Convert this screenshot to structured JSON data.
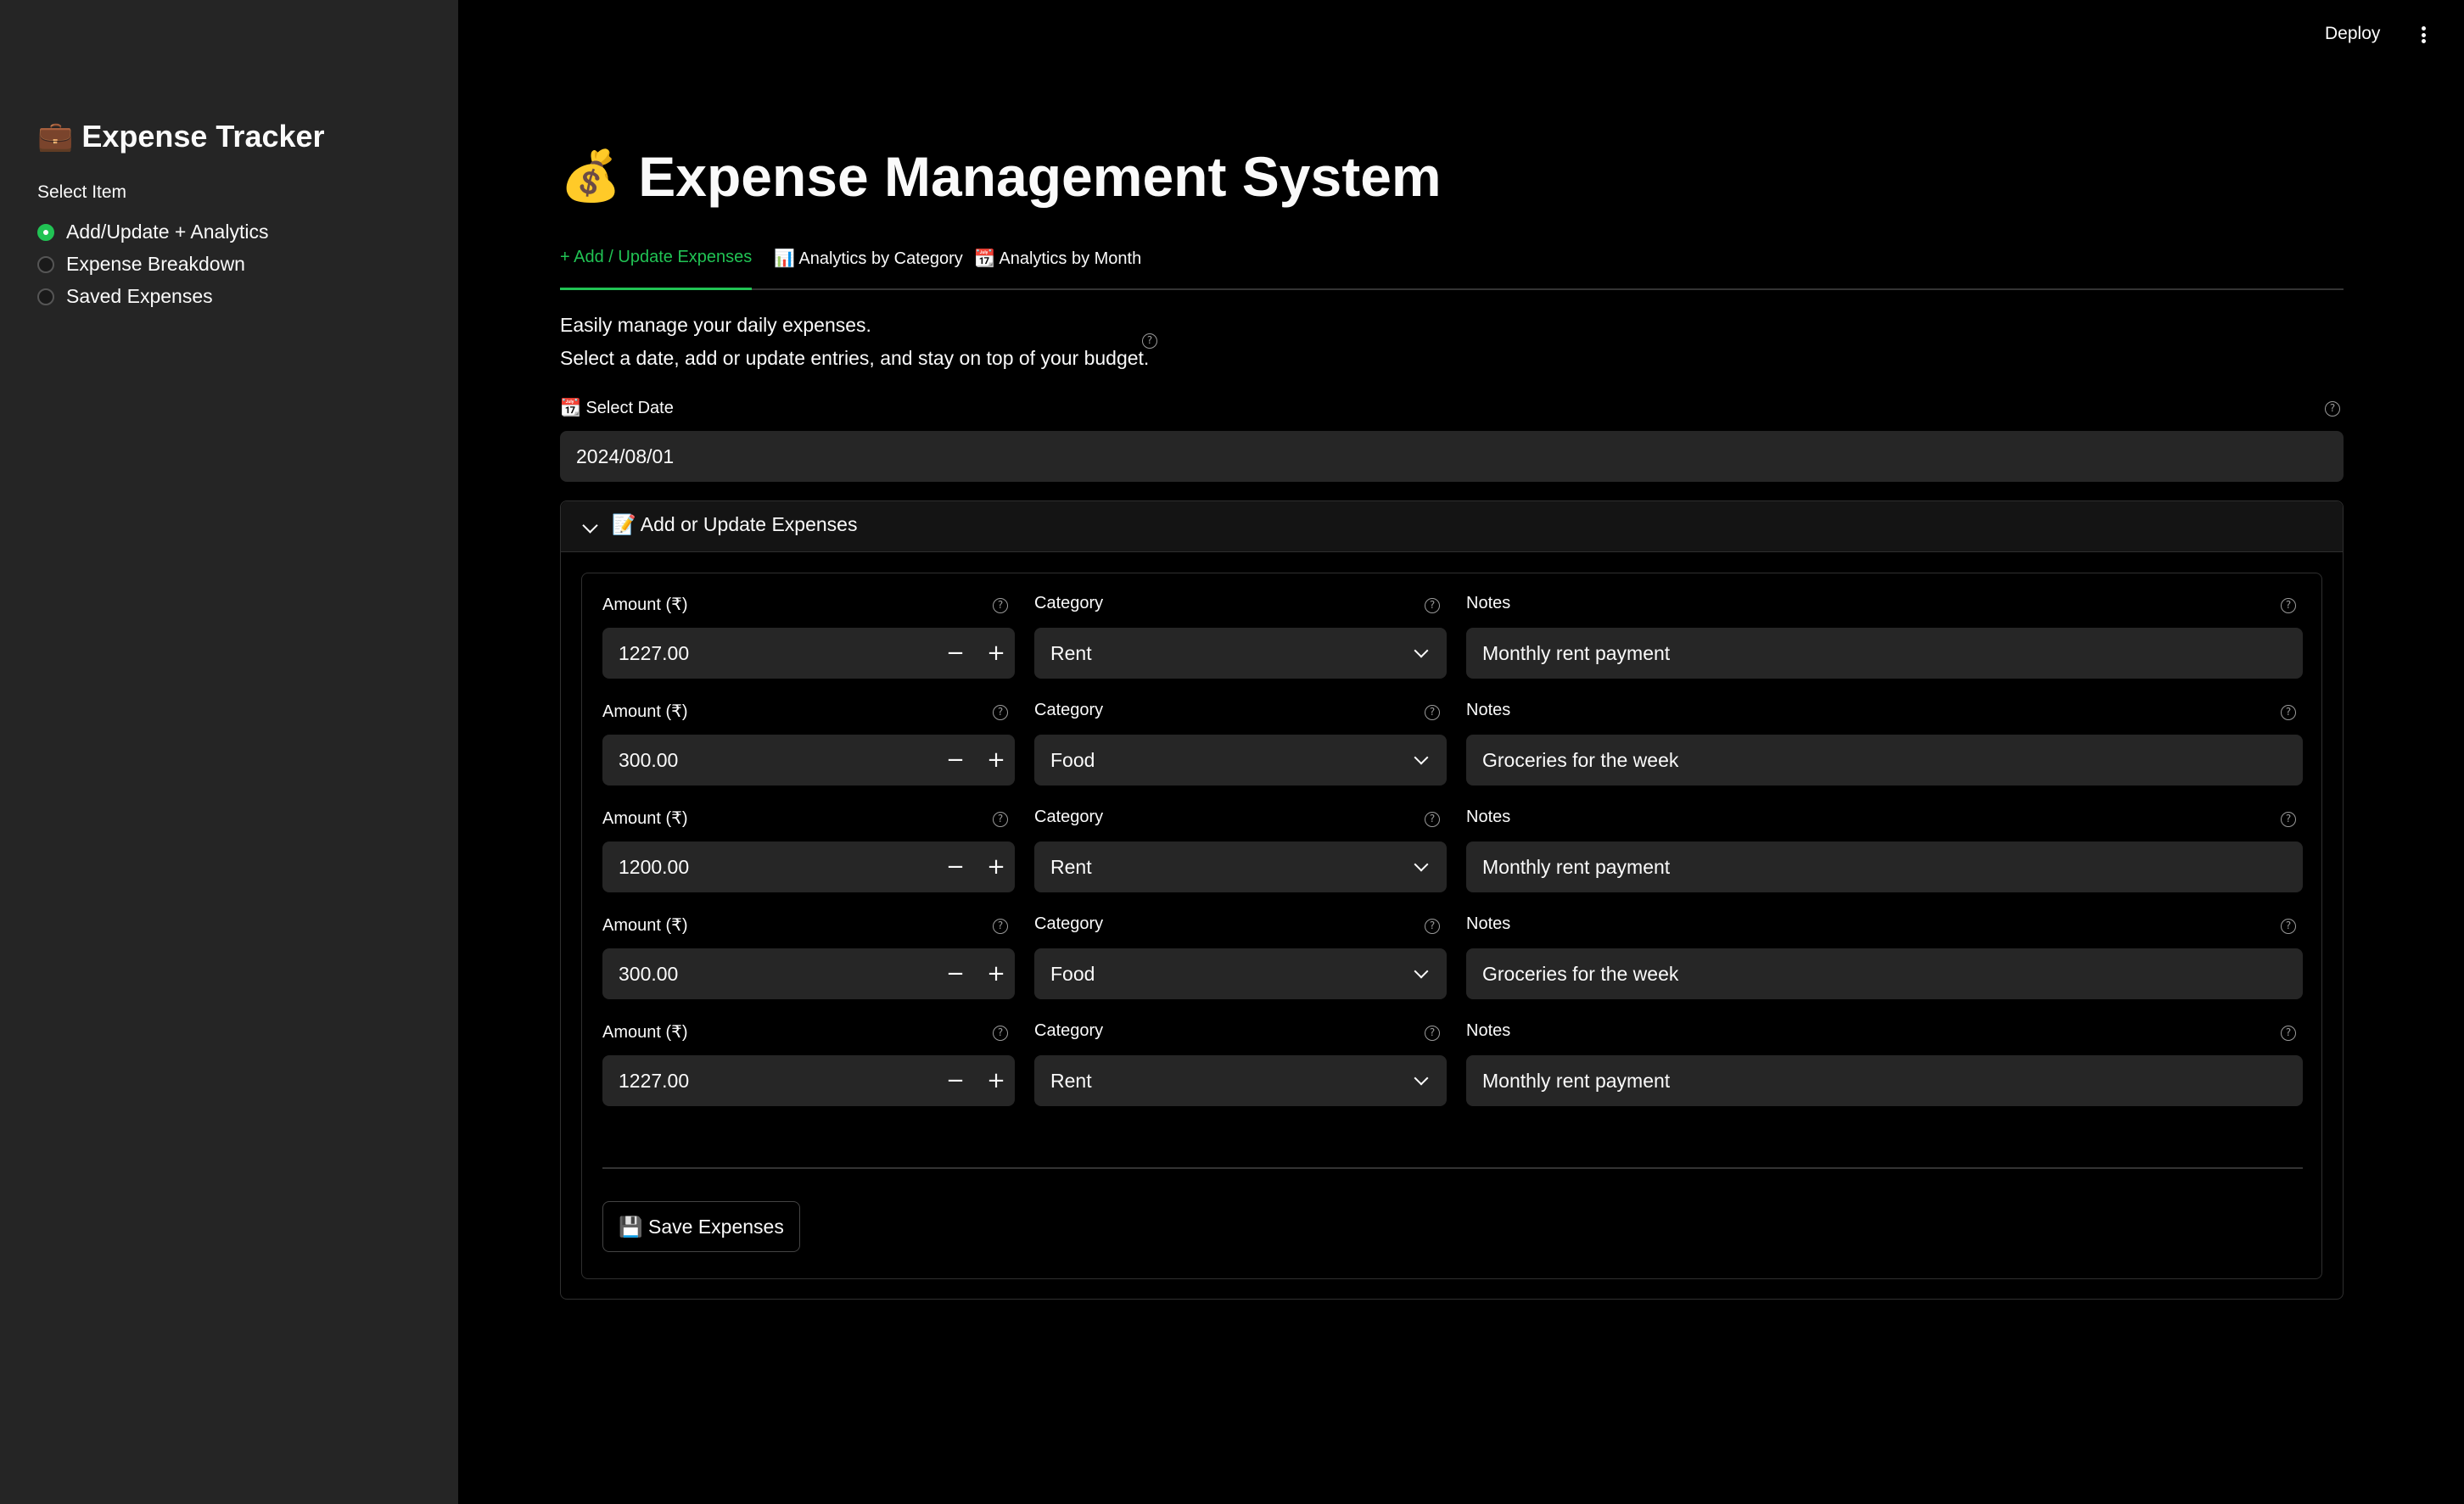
{
  "sidebar": {
    "title_icon": "briefcase-icon",
    "title_emoji": "💼",
    "title": "Expense Tracker",
    "radio_label": "Select Item",
    "options": [
      {
        "label": "Add/Update + Analytics",
        "selected": true
      },
      {
        "label": "Expense Breakdown",
        "selected": false
      },
      {
        "label": "Saved Expenses",
        "selected": false
      }
    ]
  },
  "topbar": {
    "deploy_label": "Deploy",
    "menu_icon": "kebab-menu-icon"
  },
  "main": {
    "title_emoji": "💰",
    "title": "Expense Management System",
    "tabs": [
      {
        "label": "+ Add / Update Expenses",
        "active": true
      },
      {
        "label": "📊 Analytics by Category",
        "active": false
      },
      {
        "label": "📆 Analytics by Month",
        "active": false
      }
    ],
    "description_line1": "Easily manage your daily expenses.",
    "description_line2": "Select a date, add or update entries, and stay on top of your budget.",
    "date_label": "📆 Select Date",
    "date_value": "2024/08/01",
    "expander_title": "📝 Add or Update Expenses",
    "amount_label": "Amount (₹)",
    "category_label": "Category",
    "notes_label": "Notes",
    "stepper_minus": "−",
    "stepper_plus": "+",
    "help_glyph": "?",
    "rows": [
      {
        "amount": "1227.00",
        "category": "Rent",
        "notes": "Monthly rent payment"
      },
      {
        "amount": "300.00",
        "category": "Food",
        "notes": "Groceries for the week"
      },
      {
        "amount": "1200.00",
        "category": "Rent",
        "notes": "Monthly rent payment"
      },
      {
        "amount": "300.00",
        "category": "Food",
        "notes": "Groceries for the week"
      },
      {
        "amount": "1227.00",
        "category": "Rent",
        "notes": "Monthly rent payment"
      }
    ],
    "save_label": "💾 Save Expenses"
  },
  "colors": {
    "accent": "#21c354",
    "sidebar_bg": "#252525",
    "main_bg": "#000000",
    "input_bg": "#262626"
  }
}
